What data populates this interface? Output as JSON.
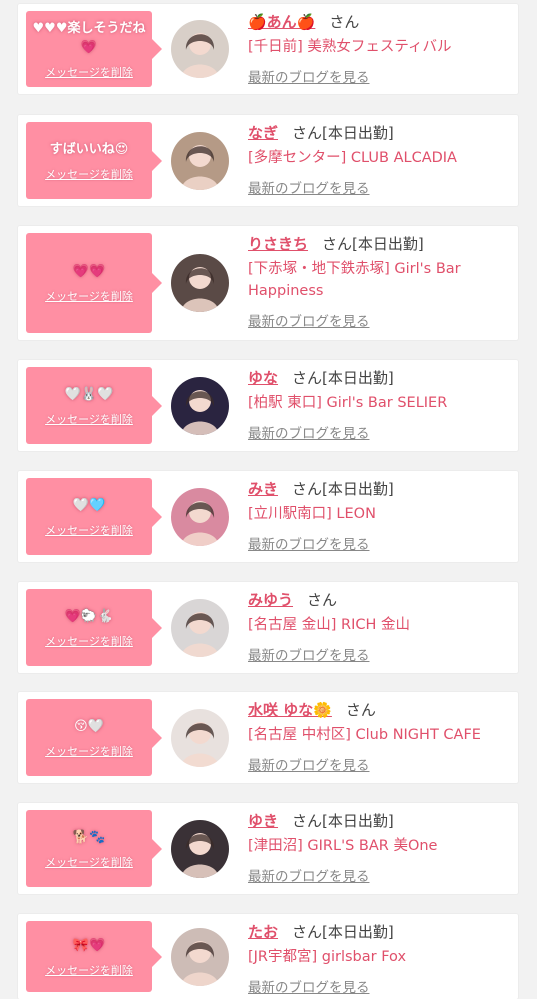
{
  "cards": [
    {
      "message": "♥♥♥楽しそうだね💗",
      "delete_label": "メッセージを削除",
      "name": "🍎あん🍎",
      "honorific": "さん",
      "status": "",
      "shop": "[千日前] 美熟女フェスティバル",
      "blog_link": "最新のブログを見る",
      "avatar_color": "#d8cfc8",
      "avatar_icon": "avatar-photo-icon"
    },
    {
      "message": "すばいいね😍",
      "delete_label": "メッセージを削除",
      "name": "なぎ",
      "honorific": "さん",
      "status": "[本日出勤]",
      "shop": "[多摩センター] CLUB ALCADIA",
      "blog_link": "最新のブログを見る",
      "avatar_color": "#b59a86",
      "avatar_icon": "avatar-photo-icon"
    },
    {
      "message": "💗💗",
      "delete_label": "メッセージを削除",
      "name": "りさきち",
      "honorific": "さん",
      "status": "[本日出勤]",
      "shop": "[下赤塚・地下鉄赤塚] Girl's Bar Happiness",
      "blog_link": "最新のブログを見る",
      "avatar_color": "#5a4a46",
      "avatar_icon": "avatar-photo-icon"
    },
    {
      "message": "🤍🐰🤍",
      "delete_label": "メッセージを削除",
      "name": "ゆな",
      "honorific": "さん",
      "status": "[本日出勤]",
      "shop": "[柏駅 東口] Girl's Bar SELIER",
      "blog_link": "最新のブログを見る",
      "avatar_color": "#2a2440",
      "avatar_icon": "avatar-photo-icon"
    },
    {
      "message": "🤍🩵",
      "delete_label": "メッセージを削除",
      "name": "みき",
      "honorific": "さん",
      "status": "[本日出勤]",
      "shop": "[立川駅南口] LEON",
      "blog_link": "最新のブログを見る",
      "avatar_color": "#d98aa0",
      "avatar_icon": "avatar-photo-icon"
    },
    {
      "message": "💗🐑🐇",
      "delete_label": "メッセージを削除",
      "name": "みゆう",
      "honorific": "さん",
      "status": "",
      "shop": "[名古屋 金山] RICH 金山",
      "blog_link": "最新のブログを見る",
      "avatar_color": "#d9d6d6",
      "avatar_icon": "avatar-photo-icon"
    },
    {
      "message": "😚🤍",
      "delete_label": "メッセージを削除",
      "name": "水咲 ゆな🌼",
      "honorific": "さん",
      "status": "",
      "shop": "[名古屋 中村区] Club NIGHT CAFE",
      "blog_link": "最新のブログを見る",
      "avatar_color": "#e8e1de",
      "avatar_icon": "avatar-photo-icon"
    },
    {
      "message": "🐕🐾",
      "delete_label": "メッセージを削除",
      "name": "ゆき",
      "honorific": "さん",
      "status": "[本日出勤]",
      "shop": "[津田沼] GIRL'S BAR 美One",
      "blog_link": "最新のブログを見る",
      "avatar_color": "#3a3136",
      "avatar_icon": "avatar-photo-icon"
    },
    {
      "message": "🎀💗",
      "delete_label": "メッセージを削除",
      "name": "たお",
      "honorific": "さん",
      "status": "[本日出勤]",
      "shop": "[JR宇都宮] girlsbar Fox",
      "blog_link": "最新のブログを見る",
      "avatar_color": "#cdbcb6",
      "avatar_icon": "avatar-photo-icon"
    }
  ]
}
